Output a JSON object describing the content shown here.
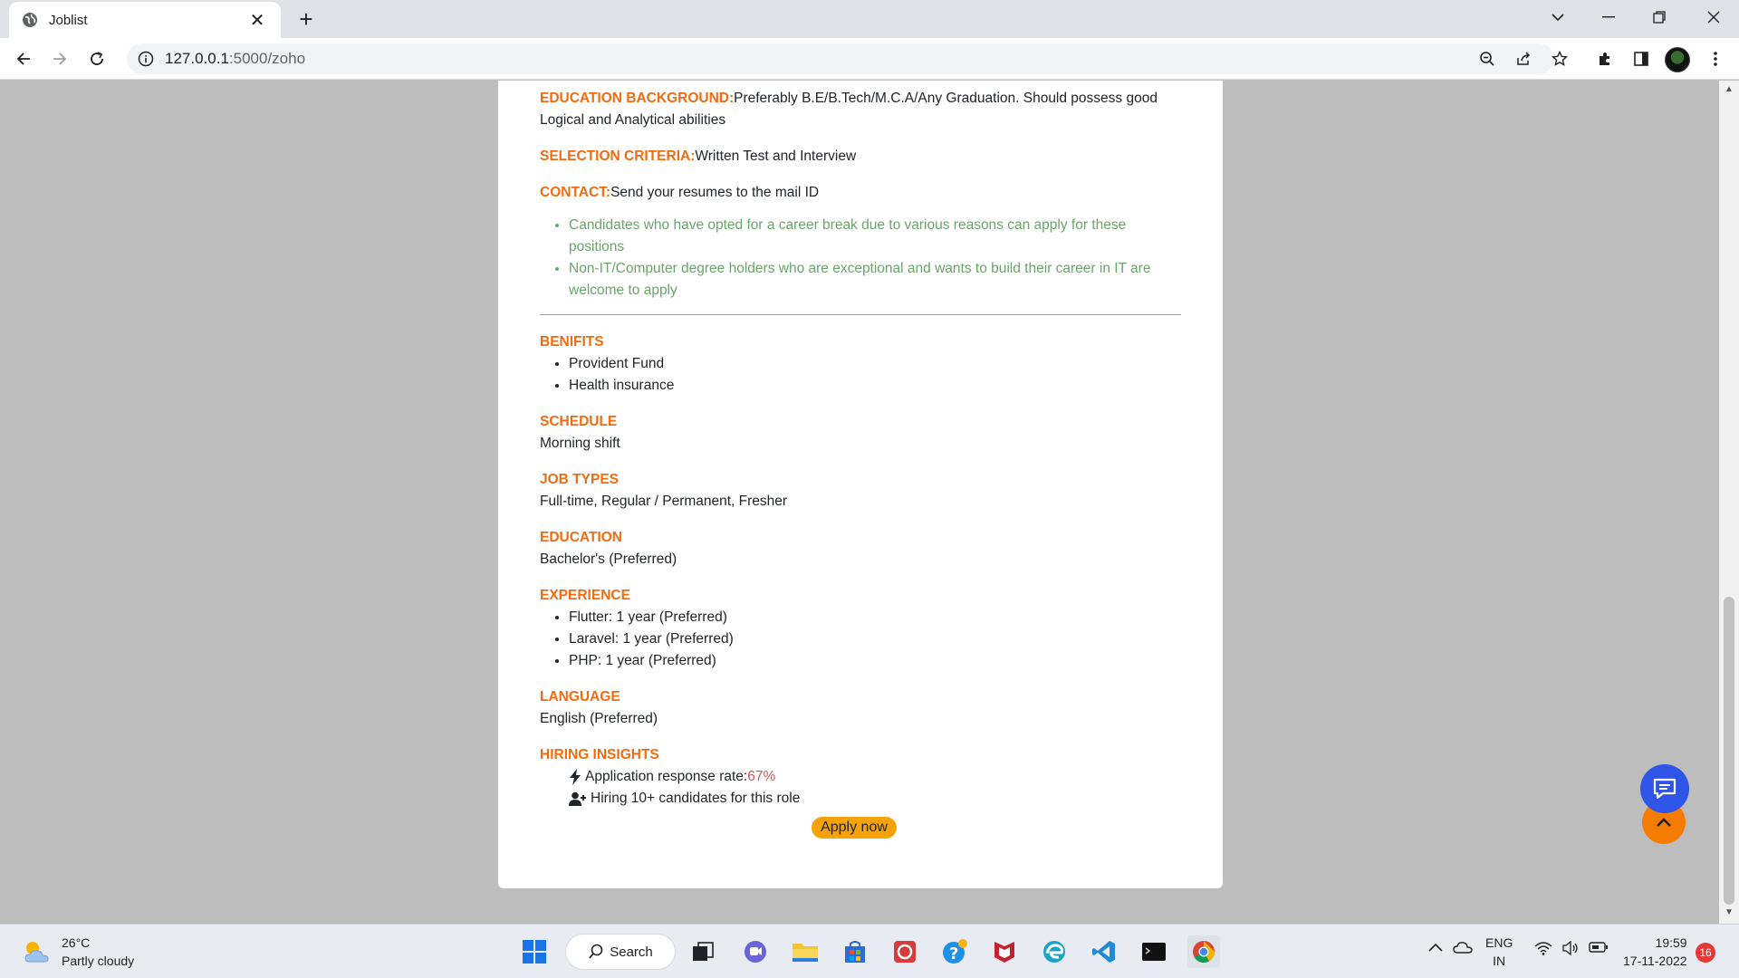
{
  "browser": {
    "tab_title": "Joblist",
    "url_host": "127.0.0.1",
    "url_rest": ":5000/zoho"
  },
  "job": {
    "education_background_label": "EDUCATION BACKGROUND:",
    "education_background_text": "Preferably B.E/B.Tech/M.C.A/Any Graduation. Should possess good Logical and Analytical abilities",
    "selection_label": "SELECTION CRITERIA:",
    "selection_text": "Written Test and Interview",
    "contact_label": "CONTACT:",
    "contact_text": "Send your resumes to the mail ID",
    "notes": [
      "Candidates who have opted for a career break due to various reasons can apply for these positions",
      "Non-IT/Computer degree holders who are exceptional and wants to build their career in IT are welcome to apply"
    ],
    "benefits_label": "BENIFITS",
    "benefits": [
      "Provident Fund",
      "Health insurance"
    ],
    "schedule_label": "SCHEDULE",
    "schedule_text": "Morning shift",
    "job_types_label": "JOB TYPES",
    "job_types_text": "Full-time, Regular / Permanent, Fresher",
    "education_label": "EDUCATION",
    "education_text": "Bachelor's (Preferred)",
    "experience_label": "EXPERIENCE",
    "experience": [
      "Flutter: 1 year (Preferred)",
      "Laravel: 1 year (Preferred)",
      "PHP: 1 year (Preferred)"
    ],
    "language_label": "LANGUAGE",
    "language_text": "English (Preferred)",
    "insights_label": "HIRING INSIGHTS",
    "response_rate_label": "Application response rate:",
    "response_rate_value": "67%",
    "hiring_text": "Hiring 10+ candidates for this role",
    "apply_label": "Apply now"
  },
  "taskbar": {
    "temperature": "26°C",
    "weather": "Partly cloudy",
    "search_label": "Search",
    "lang_top": "ENG",
    "lang_bottom": "IN",
    "time": "19:59",
    "date": "17-11-2022",
    "notification_count": "16"
  },
  "colors": {
    "accent_orange": "#f26b0f",
    "note_green": "#6aa56a",
    "apply_button": "#f5a20b",
    "chat_fab": "#2e55e8"
  }
}
